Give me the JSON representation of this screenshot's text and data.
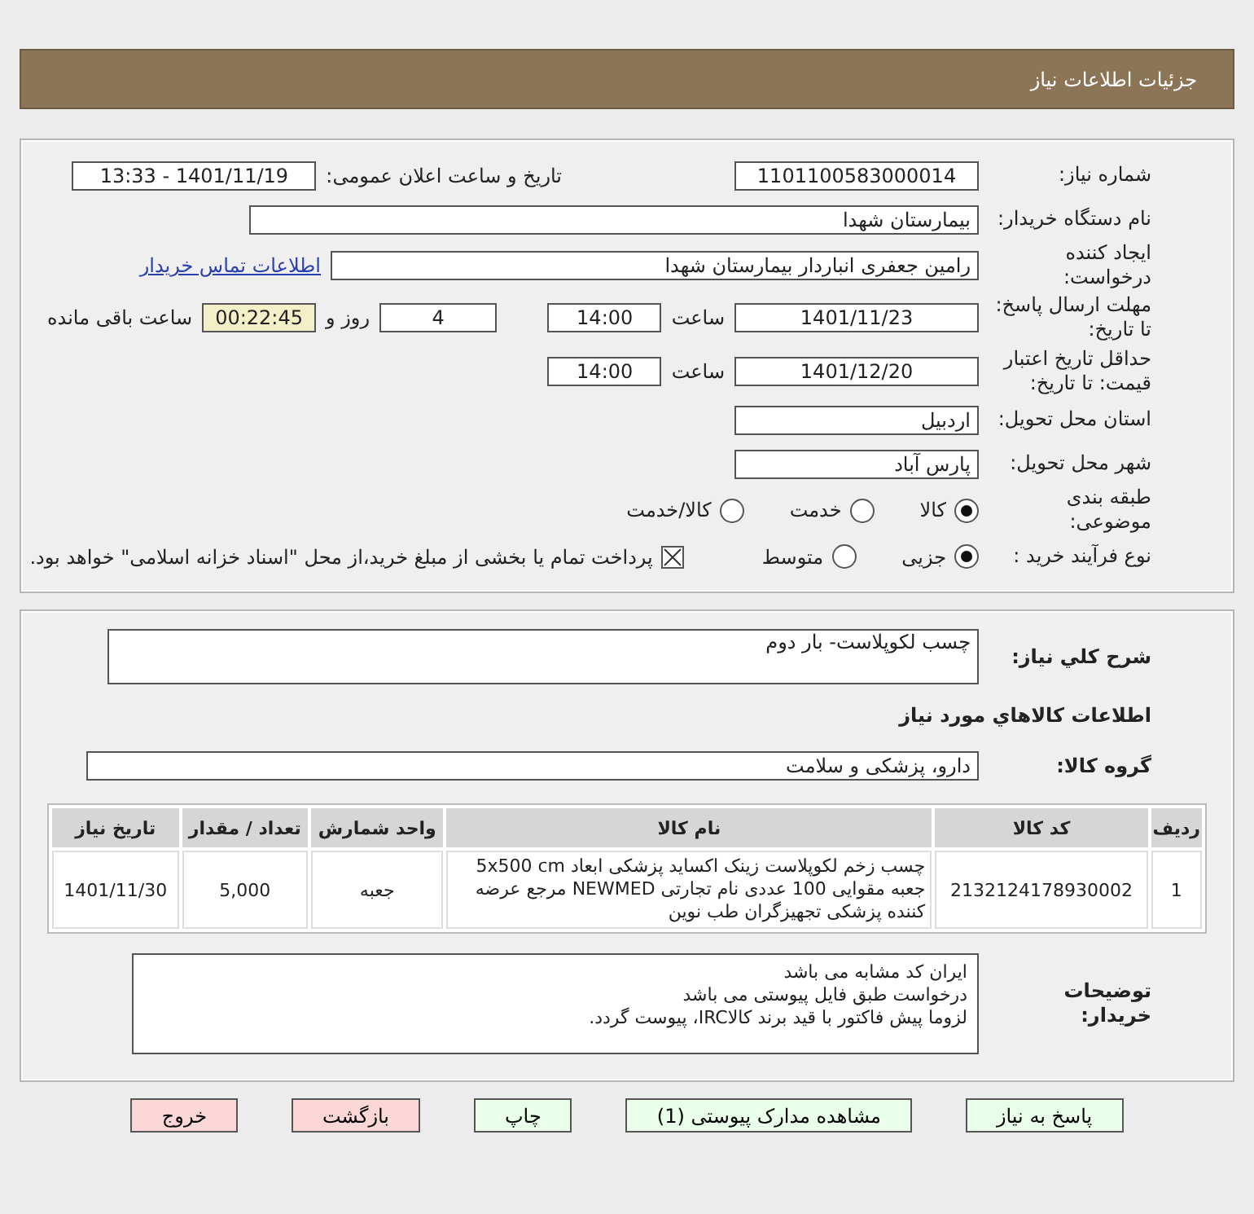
{
  "title": "جزئیات اطلاعات نیاز",
  "need_number": {
    "label": "شماره نیاز:",
    "value": "1101100583000014"
  },
  "announce": {
    "label": "تاریخ و ساعت اعلان عمومی:",
    "value": "1401/11/19 - 13:33"
  },
  "buyer_org": {
    "label": "نام دستگاه خریدار:",
    "value": "بیمارستان شهدا"
  },
  "requester": {
    "label": "ایجاد کننده درخواست:",
    "value": "رامین جعفری انباردار بیمارستان شهدا",
    "link": "اطلاعات تماس خریدار"
  },
  "deadline": {
    "label": "مهلت ارسال پاسخ: تا تاریخ:",
    "date": "1401/11/23",
    "time_label": "ساعت",
    "time": "14:00",
    "days": "4",
    "days_label": "روز و",
    "remaining": "00:22:45",
    "remaining_label": "ساعت باقی مانده"
  },
  "validity": {
    "label": "حداقل تاریخ اعتبار قیمت: تا تاریخ:",
    "date": "1401/12/20",
    "time_label": "ساعت",
    "time": "14:00"
  },
  "province": {
    "label": "استان محل تحویل:",
    "value": "اردبیل"
  },
  "city": {
    "label": "شهر محل تحویل:",
    "value": "پارس آباد"
  },
  "category": {
    "label": "طبقه بندی موضوعی:",
    "options": [
      {
        "label": "کالا",
        "selected": true
      },
      {
        "label": "خدمت",
        "selected": false
      },
      {
        "label": "کالا/خدمت",
        "selected": false
      }
    ]
  },
  "process": {
    "label": "نوع فرآیند خرید :",
    "options": [
      {
        "label": "جزیی",
        "selected": true
      },
      {
        "label": "متوسط",
        "selected": false
      }
    ],
    "payment": {
      "checked": true,
      "text": "پرداخت تمام یا بخشی از مبلغ خرید،از محل \"اسناد خزانه اسلامی\" خواهد بود."
    }
  },
  "description": {
    "label": "شرح كلي نياز:",
    "value": "چسب لکوپلاست- بار دوم"
  },
  "items_heading": "اطلاعات كالاهاي مورد نياز",
  "goods_group": {
    "label": "گروه کالا:",
    "value": "دارو، پزشکی و سلامت"
  },
  "table": {
    "columns": [
      "ردیف",
      "کد کالا",
      "نام کالا",
      "واحد شمارش",
      "تعداد / مقدار",
      "تاریخ نیاز"
    ],
    "rows": [
      [
        "1",
        "2132124178930002",
        "چسب زخم لکوپلاست زینک اکساید پزشکی ابعاد 5x500 cm جعبه مقوایی 100 عددی نام تجارتی NEWMED مرجع عرضه کننده پزشکی تجهیزگران طب نوین",
        "جعبه",
        "5,000",
        "1401/11/30"
      ]
    ]
  },
  "notes": {
    "label": "توضیحات خریدار:",
    "lines": [
      "ایران کد مشابه می باشد",
      "درخواست طبق فایل پیوستی می باشد",
      "لزوما پیش فاکتور با قید برند کالاIRC،  پیوست گردد."
    ]
  },
  "buttons": [
    {
      "label": "پاسخ به نیاز",
      "kind": "normal"
    },
    {
      "label": "مشاهده مدارک پیوستی (1)",
      "kind": "normal"
    },
    {
      "label": "چاپ",
      "kind": "normal"
    },
    {
      "label": "بازگشت",
      "kind": "danger"
    },
    {
      "label": "خروج",
      "kind": "danger"
    }
  ]
}
